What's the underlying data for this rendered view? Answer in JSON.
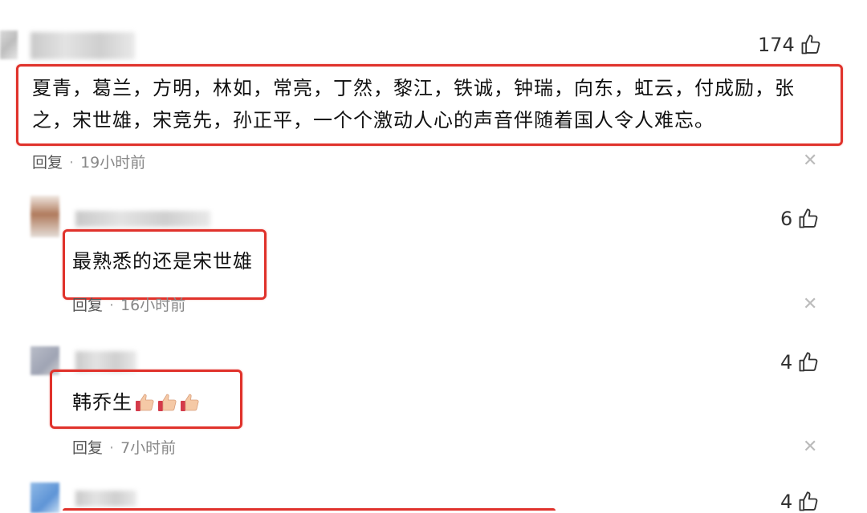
{
  "comments": [
    {
      "likes": "174",
      "text_line1": "夏青，葛兰，方明，林如，常亮，丁然，黎江，铁诚，钟瑞，向东，虹云，付成励，张",
      "text_line2": "之，宋世雄，宋竞先，孙正平，一个个激动人心的声音伴随着国人令人难忘。",
      "reply_label": "回复",
      "time": "19小时前"
    },
    {
      "likes": "6",
      "text": "最熟悉的还是宋世雄",
      "reply_label": "回复",
      "time": "16小时前"
    },
    {
      "likes": "4",
      "text": "韩乔生",
      "reply_label": "回复",
      "time": "7小时前"
    },
    {
      "likes": "4"
    }
  ],
  "icons": {
    "like": "thumbs-up-outline-icon",
    "close": "close-x-icon",
    "emoji": "thumbs-up-emoji"
  },
  "colors": {
    "highlight_border": "#e0322b",
    "text": "#111111",
    "meta": "#888888"
  }
}
